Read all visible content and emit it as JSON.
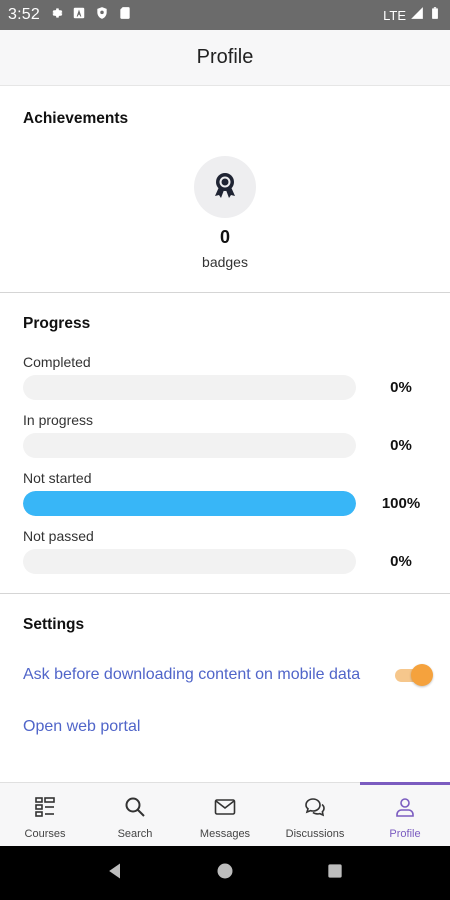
{
  "status_bar": {
    "time": "3:52",
    "network": "LTE",
    "icons": [
      "settings-icon",
      "a-icon",
      "shield-icon",
      "sd-card-icon",
      "signal-icon",
      "battery-icon"
    ]
  },
  "app_bar": {
    "title": "Profile"
  },
  "achievements": {
    "title": "Achievements",
    "badge_count": "0",
    "badge_label": "badges",
    "badge_icon": "award-icon"
  },
  "progress": {
    "title": "Progress",
    "items": [
      {
        "label": "Completed",
        "value": "0%",
        "fraction": 0
      },
      {
        "label": "In progress",
        "value": "0%",
        "fraction": 0
      },
      {
        "label": "Not started",
        "value": "100%",
        "fraction": 1
      },
      {
        "label": "Not passed",
        "value": "0%",
        "fraction": 0
      }
    ],
    "fill_color": "#38b6f7"
  },
  "settings": {
    "title": "Settings",
    "download_toggle_label": "Ask before downloading content on mobile data",
    "download_toggle_on": true,
    "web_portal_label": "Open web portal",
    "link_color": "#5065c9",
    "toggle_color": "#f5a23d"
  },
  "bottom_nav": {
    "items": [
      {
        "label": "Courses",
        "icon": "courses-icon"
      },
      {
        "label": "Search",
        "icon": "search-icon"
      },
      {
        "label": "Messages",
        "icon": "mail-icon"
      },
      {
        "label": "Discussions",
        "icon": "chat-icon"
      },
      {
        "label": "Profile",
        "icon": "profile-icon"
      }
    ],
    "active": "Profile",
    "active_color": "#7b5cc0"
  }
}
